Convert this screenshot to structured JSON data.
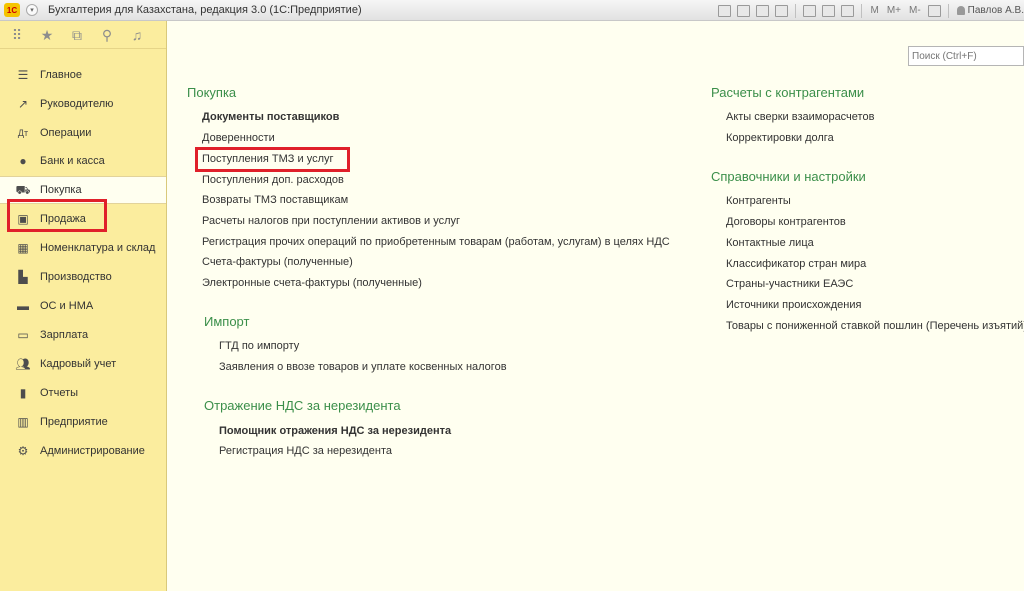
{
  "window": {
    "logo": "1С",
    "title": "Бухгалтерия для Казахстана, редакция 3.0  (1С:Предприятие)",
    "mem_labels": [
      "M",
      "M+",
      "M-"
    ],
    "user": "Павлов А.В."
  },
  "search": {
    "placeholder": "Поиск (Ctrl+F)"
  },
  "sidebar": {
    "toolbar_icons": [
      "apps-grid-icon",
      "star-icon",
      "history-icon",
      "search-icon",
      "bell-icon"
    ],
    "items": [
      {
        "label": "Главное",
        "icon": "menu-lines-icon"
      },
      {
        "label": "Руководителю",
        "icon": "trend-chart-icon"
      },
      {
        "label": "Операции",
        "icon": "operations-icon"
      },
      {
        "label": "Банк и касса",
        "icon": "coins-icon"
      },
      {
        "label": "Покупка",
        "icon": "shopping-cart-icon",
        "active": true
      },
      {
        "label": "Продажа",
        "icon": "shopping-bag-icon"
      },
      {
        "label": "Номенклатура и склад",
        "icon": "boxes-icon"
      },
      {
        "label": "Производство",
        "icon": "factory-icon"
      },
      {
        "label": "ОС и НМА",
        "icon": "truck-icon"
      },
      {
        "label": "Зарплата",
        "icon": "money-icon"
      },
      {
        "label": "Кадровый учет",
        "icon": "people-icon"
      },
      {
        "label": "Отчеты",
        "icon": "bar-chart-icon"
      },
      {
        "label": "Предприятие",
        "icon": "building-icon"
      },
      {
        "label": "Администрирование",
        "icon": "gear-icon"
      }
    ]
  },
  "sections": {
    "pokupka": {
      "title": "Покупка",
      "links": [
        "Документы поставщиков",
        "Доверенности",
        "Поступления ТМЗ и услуг",
        "Поступления доп. расходов",
        "Возвраты ТМЗ поставщикам",
        "Расчеты налогов при поступлении активов и услуг",
        "Регистрация прочих операций по приобретенным товарам (работам, услугам) в целях НДС",
        "Счета-фактуры (полученные)",
        "Электронные счета-фактуры (полученные)"
      ]
    },
    "import": {
      "title": "Импорт",
      "links": [
        "ГТД по импорту",
        "Заявления о ввозе товаров и уплате косвенных налогов"
      ]
    },
    "nds": {
      "title": "Отражение НДС за нерезидента",
      "links": [
        "Помощник отражения НДС за нерезидента",
        "Регистрация НДС за нерезидента"
      ]
    },
    "raschety": {
      "title": "Расчеты с контрагентами",
      "links": [
        "Акты сверки взаиморасчетов",
        "Корректировки долга"
      ]
    },
    "sprav": {
      "title": "Справочники и настройки",
      "links": [
        "Контрагенты",
        "Договоры контрагентов",
        "Контактные лица",
        "Классификатор стран мира",
        "Страны-участники ЕАЭС",
        "Источники происхождения",
        "Товары с пониженной ставкой пошлин (Перечень изъятий)"
      ]
    }
  },
  "colors": {
    "section_title": "#3b8f4a",
    "sidebar_bg": "#fbed9e",
    "highlight": "#e0202a",
    "content_bg": "#fffff0"
  }
}
